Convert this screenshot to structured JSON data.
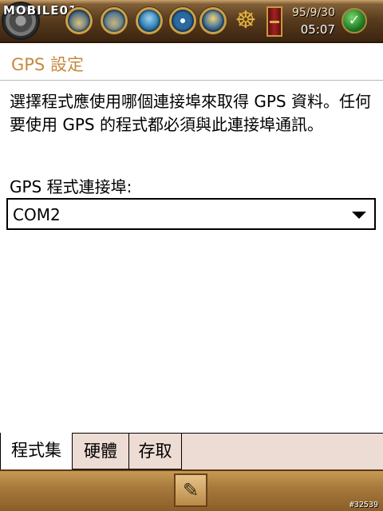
{
  "status_bar": {
    "logo": "MOBILE01",
    "date": "95/9/30",
    "time": "05:07",
    "icons": [
      "gear-icon",
      "ship-icon",
      "sailboat-icon",
      "sea-icon",
      "compass-icon",
      "bell-icon",
      "ship-wheel-icon",
      "book-icon",
      "ok-icon"
    ]
  },
  "page": {
    "title": "GPS 設定",
    "description": "選擇程式應使用哪個連接埠來取得 GPS 資料。任何要使用 GPS 的程式都必須與此連接埠通訊。",
    "port_label": "GPS 程式連接埠:",
    "port_value": "COM2"
  },
  "tabs": [
    {
      "label": "程式集",
      "active": true
    },
    {
      "label": "硬體",
      "active": false
    },
    {
      "label": "存取",
      "active": false
    }
  ],
  "bottom_bar": {
    "keyboard_icon": "keyboard-pen-icon",
    "watermark": "#32539"
  },
  "colors": {
    "title": "#c6893f",
    "tab_background": "#eddcd4"
  }
}
